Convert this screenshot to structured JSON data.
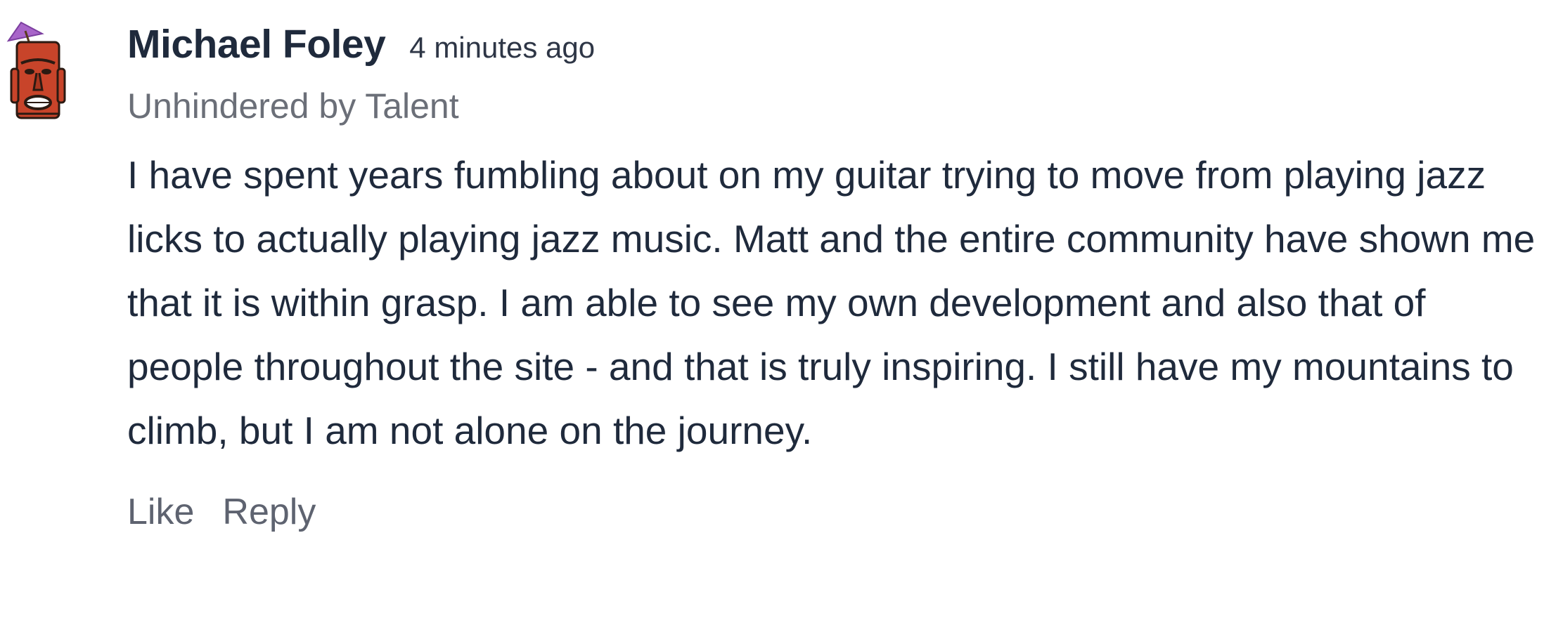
{
  "comment": {
    "author": "Michael Foley",
    "timestamp": "4 minutes ago",
    "subtitle": "Unhindered by Talent",
    "body": "I have spent years fumbling about on my guitar trying to move from playing jazz licks to actually playing jazz music. Matt and the entire community have shown me that it is within grasp. I am able to see my own development and also that of people throughout the site - and that is truly inspiring. I still have my mountains to climb, but I am not alone on the journey.",
    "actions": {
      "like_label": "Like",
      "reply_label": "Reply"
    },
    "avatar_icon": "tiki-mask-icon"
  },
  "colors": {
    "text_primary": "#1f2a3c",
    "text_muted": "#6b6f78",
    "action_text": "#5e6370",
    "avatar_red": "#c8442a",
    "umbrella_purple": "#a865c9"
  }
}
